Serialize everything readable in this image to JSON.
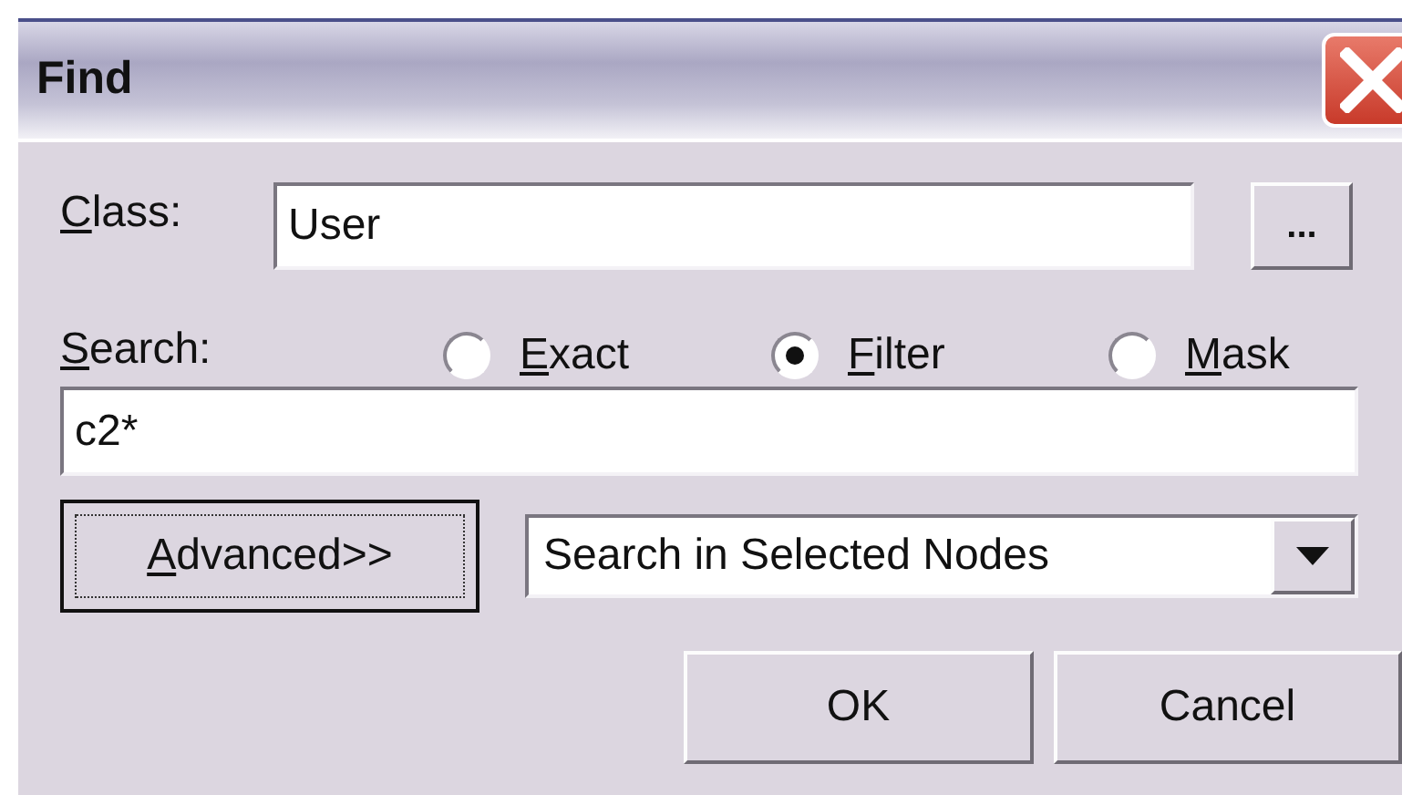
{
  "window": {
    "title": "Find"
  },
  "class_field": {
    "label": "Class:",
    "access_key_underlined": true,
    "value": "User"
  },
  "browse_button": {
    "label": "..."
  },
  "search": {
    "label": "Search:",
    "access_key_underlined": true,
    "value": "c2*"
  },
  "modes": [
    {
      "label": "Exact",
      "access_key_underlined": true,
      "selected": false
    },
    {
      "label": "Filter",
      "access_key_underlined": true,
      "selected": true
    },
    {
      "label": "Mask",
      "access_key_underlined": true,
      "selected": false
    }
  ],
  "advanced_button": {
    "label": "Advanced>>",
    "access_key_underlined": true,
    "focused": true
  },
  "scope_dropdown": {
    "value": "Search in Selected Nodes"
  },
  "buttons": [
    {
      "label": "OK"
    },
    {
      "label": "Cancel"
    }
  ]
}
